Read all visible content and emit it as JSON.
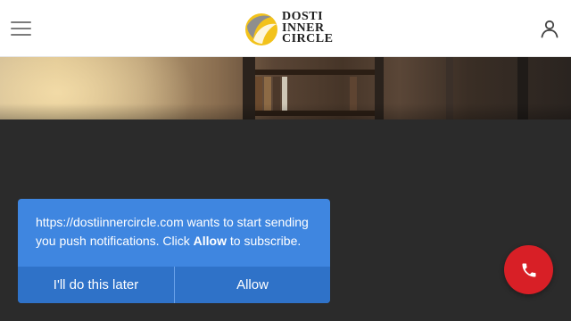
{
  "header": {
    "menu_icon": "hamburger-menu-icon",
    "logo": {
      "line1": "DOSTI",
      "line2": "INNER",
      "line3": "CIRCLE",
      "colors": {
        "gold": "#f2c21b",
        "grey": "#8e8e8e"
      }
    },
    "user_icon": "user-account-icon"
  },
  "notification": {
    "message_before": "https://dostiinnercircle.com wants to start sending you push notifications. Click ",
    "message_bold": "Allow",
    "message_after": " to subscribe.",
    "later_label": "I'll do this later",
    "allow_label": "Allow",
    "accent": "#3f86e0"
  },
  "call_button": {
    "icon": "phone-icon",
    "color": "#d81f26"
  },
  "colors": {
    "page_background": "#2b2b2b",
    "header_background": "#ffffff"
  }
}
